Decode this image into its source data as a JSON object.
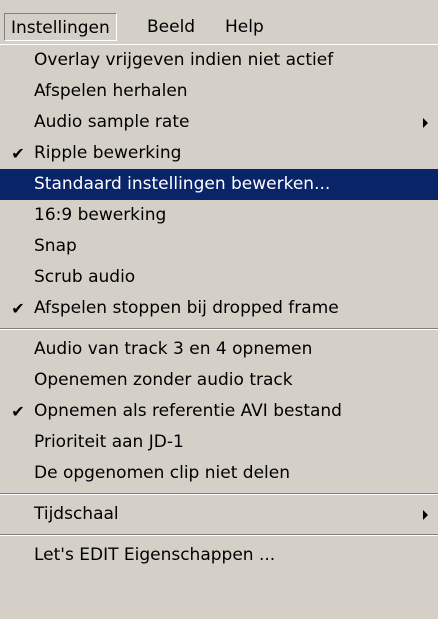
{
  "menubar": {
    "items": [
      {
        "label": "Instellingen"
      },
      {
        "label": "Beeld"
      },
      {
        "label": "Help"
      }
    ]
  },
  "menu": {
    "group1": [
      {
        "label": "Overlay vrijgeven indien niet actief",
        "checked": false
      },
      {
        "label": "Afspelen herhalen",
        "checked": false
      },
      {
        "label": "Audio sample rate",
        "checked": false,
        "submenu": true
      },
      {
        "label": "Ripple bewerking",
        "checked": true,
        "check_glyph": "✔"
      },
      {
        "label": "Standaard instellingen bewerken...",
        "checked": false,
        "highlighted": true
      },
      {
        "label": "16:9 bewerking",
        "checked": false
      },
      {
        "label": "Snap",
        "checked": false
      },
      {
        "label": "Scrub audio",
        "checked": false
      },
      {
        "label": "Afspelen stoppen bij dropped frame",
        "checked": true,
        "check_glyph": "✔"
      }
    ],
    "group2": [
      {
        "label": "Audio van track 3 en 4 opnemen",
        "checked": false
      },
      {
        "label": "Openemen zonder audio track",
        "checked": false
      },
      {
        "label": "Opnemen als referentie AVI bestand",
        "checked": true,
        "check_glyph": "✔"
      },
      {
        "label": "Prioriteit aan JD-1",
        "checked": false
      },
      {
        "label": "De opgenomen clip niet delen",
        "checked": false
      }
    ],
    "group3": [
      {
        "label": "Tijdschaal",
        "checked": false,
        "submenu": true
      }
    ],
    "group4": [
      {
        "label": "Let's EDIT Eigenschappen ...",
        "checked": false
      }
    ]
  },
  "colors": {
    "face": "#d4d0c8",
    "highlight": "#0a246a",
    "highlight_text": "#ffffff"
  },
  "icons": {
    "check": "check-icon",
    "submenu_arrow": "submenu-arrow-icon"
  }
}
